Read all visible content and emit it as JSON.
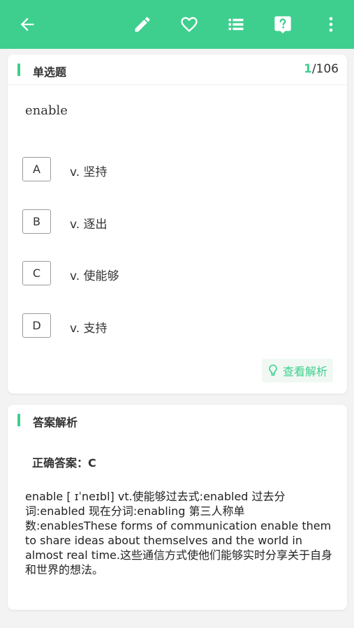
{
  "toolbar": {
    "back_icon": "arrow-left-icon",
    "edit_icon": "pencil-icon",
    "favorite_icon": "heart-outline-icon",
    "list_icon": "list-icon",
    "help_icon": "question-bubble-icon",
    "more_icon": "more-vertical-icon",
    "color": "#3ecf8e"
  },
  "question_card": {
    "section_title": "单选题",
    "current_index": "1",
    "total": "/106",
    "question": "enable",
    "options": [
      {
        "letter": "A",
        "text": "v. 坚持"
      },
      {
        "letter": "B",
        "text": "v. 逐出"
      },
      {
        "letter": "C",
        "text": "v. 使能够"
      },
      {
        "letter": "D",
        "text": "v. 支持"
      }
    ],
    "analysis_button_label": "查看解析",
    "analysis_button_icon": "lightbulb-icon"
  },
  "analysis_card": {
    "section_title": "答案解析",
    "answer_label": "正确答案：C",
    "explanation": " enable [ ɪˈneɪbl] vt.使能够过去式:enabled 过去分词:enabled 现在分词:enabling 第三人称单数:enablesThese forms of communication enable them to share ideas about themselves and the world in almost real time.这些通信方式使他们能够实时分享关于自身和世界的想法。"
  }
}
